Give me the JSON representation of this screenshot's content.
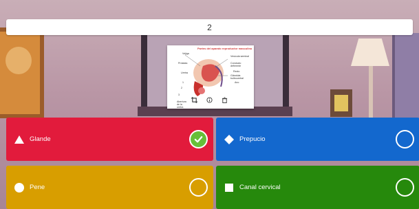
{
  "question": {
    "number": "2"
  },
  "media": {
    "title": "Partes del aparato reproductor masculino",
    "labels_left": [
      "Vejiga",
      "Próstata",
      "Uretra",
      "1",
      "2",
      "3",
      "Abertura de la uretra"
    ],
    "labels_right": [
      "Vesícula seminal",
      "Conducto deferente",
      "Recto",
      "Glándula bulbouretral",
      "Ano"
    ],
    "toolbar": {
      "crop_icon": "crop-icon",
      "info_icon": "info-icon",
      "delete_icon": "trash-icon"
    }
  },
  "answers": [
    {
      "label": "Glande",
      "shape": "triangle",
      "color": "#e21b3c",
      "correct": true
    },
    {
      "label": "Prepucio",
      "shape": "diamond",
      "color": "#1368ce",
      "correct": false
    },
    {
      "label": "Pene",
      "shape": "circle",
      "color": "#d89e00",
      "correct": false
    },
    {
      "label": "Canal cervical",
      "shape": "square",
      "color": "#26890c",
      "correct": false
    }
  ]
}
